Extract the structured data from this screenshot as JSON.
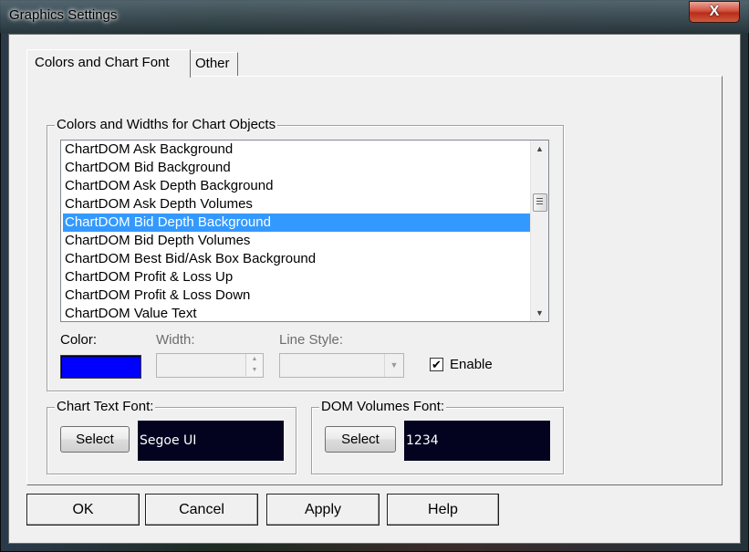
{
  "window": {
    "title": "Graphics Settings",
    "close_label": "X"
  },
  "tabs": [
    {
      "label": "Colors and Chart Font",
      "active": true
    },
    {
      "label": "Other",
      "active": false
    }
  ],
  "colors_group": {
    "title": "Colors and Widths for Chart Objects",
    "items": [
      "ChartDOM Ask Background",
      "ChartDOM Bid Background",
      "ChartDOM Ask Depth Background",
      "ChartDOM Ask Depth Volumes",
      "ChartDOM Bid Depth Background",
      "ChartDOM Bid Depth Volumes",
      "ChartDOM Best Bid/Ask Box Background",
      "ChartDOM Profit & Loss Up",
      "ChartDOM Profit & Loss Down",
      "ChartDOM Value Text"
    ],
    "selected_item": "ChartDOM Bid Depth Background",
    "color_label": "Color:",
    "color_value": "#0000ff",
    "width_label": "Width:",
    "width_value": "",
    "line_style_label": "Line Style:",
    "line_style_value": "",
    "enable_label": "Enable",
    "enable_checked": true,
    "check_mark": "✔"
  },
  "chart_text_font": {
    "title": "Chart Text Font:",
    "select_label": "Select",
    "preview_text": "Segoe UI"
  },
  "dom_volumes_font": {
    "title": "DOM Volumes Font:",
    "select_label": "Select",
    "preview_text": "1234"
  },
  "buttons": {
    "ok": "OK",
    "cancel": "Cancel",
    "apply": "Apply",
    "help": "Help"
  }
}
